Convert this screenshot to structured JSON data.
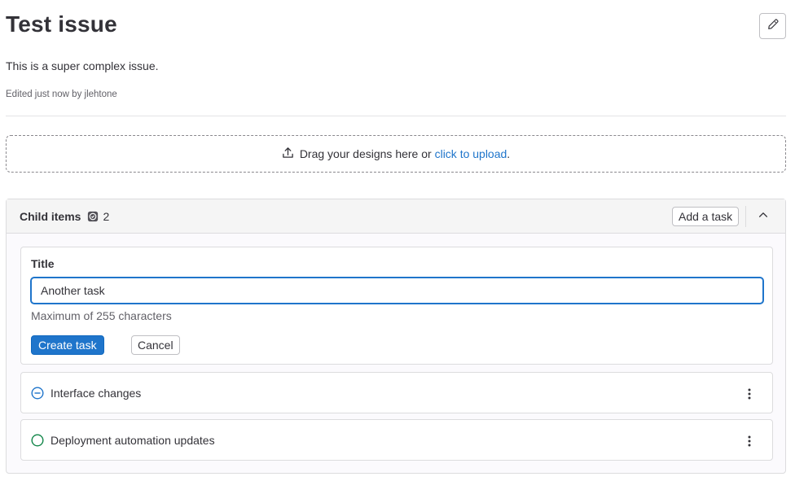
{
  "issue": {
    "title": "Test issue",
    "description": "This is a super complex issue.",
    "edited_note": "Edited just now by jlehtone"
  },
  "design_dropzone": {
    "text": "Drag your designs here or",
    "link_text": "click to upload",
    "suffix": "."
  },
  "child_items": {
    "title": "Child items",
    "count": "2",
    "add_button_label": "Add a task",
    "form": {
      "label": "Title",
      "input_value": "Another task",
      "helper_text": "Maximum of 255 characters",
      "create_label": "Create task",
      "cancel_label": "Cancel"
    },
    "items": [
      {
        "title": "Interface changes",
        "status_icon": "issue-open-partial-icon"
      },
      {
        "title": "Deployment automation updates",
        "status_icon": "issue-open-icon"
      }
    ]
  },
  "colors": {
    "accent": "#1f75cb",
    "open_status": "#108548",
    "in_progress_status": "#1f75cb"
  }
}
